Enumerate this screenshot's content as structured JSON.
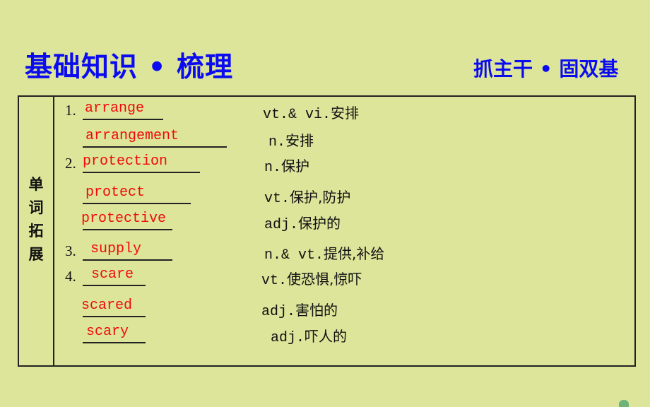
{
  "header": {
    "title": "基础知识 • 梳理",
    "subtitle": "抓主干 • 固双基"
  },
  "table": {
    "side_label": [
      "单",
      "词",
      "拓",
      "展"
    ],
    "rows": [
      {
        "num": "1.",
        "answer": "arrange",
        "pos": "vt.& vi.",
        "meaning": "安排"
      },
      {
        "num": "",
        "answer": "arrangement",
        "pos": "n.",
        "meaning": "安排"
      },
      {
        "num": "2.",
        "answer": "protection",
        "pos": "n.",
        "meaning": "保护"
      },
      {
        "num": "",
        "answer": "protect",
        "pos": "vt.",
        "meaning": "保护,防护"
      },
      {
        "num": "",
        "answer": "protective",
        "pos": "adj.",
        "meaning": "保护的"
      },
      {
        "num": "3.",
        "answer": "supply",
        "pos": "n.& vt.",
        "meaning": "提供,补给"
      },
      {
        "num": "4.",
        "answer": "scare",
        "pos": "vt.",
        "meaning": "使恐惧,惊吓"
      },
      {
        "num": "",
        "answer": "scared",
        "pos": "adj.",
        "meaning": "害怕的"
      },
      {
        "num": "",
        "answer": "scary",
        "pos": "adj.",
        "meaning": "吓人的"
      }
    ]
  },
  "colors": {
    "background": "#dce59a",
    "title": "#0b0bf0",
    "answer": "#f00a0a"
  }
}
